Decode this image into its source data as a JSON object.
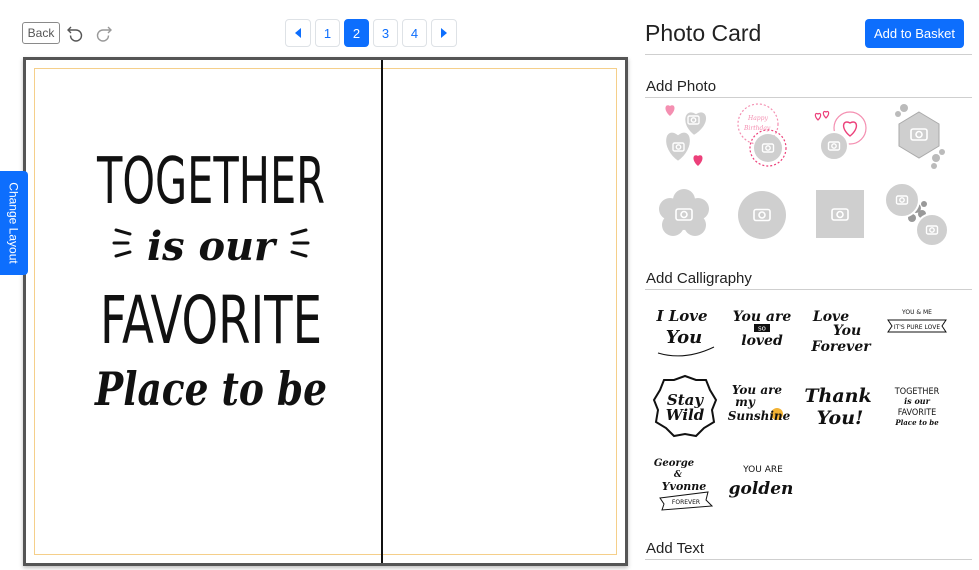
{
  "toolbar": {
    "back_label": "Back",
    "undo_icon": "undo-icon",
    "redo_icon": "redo-icon",
    "pages": [
      "1",
      "2",
      "3",
      "4"
    ],
    "active_page": "2",
    "prev_icon": "caret-left-icon",
    "next_icon": "caret-right-icon"
  },
  "canvas": {
    "art_lines": [
      "TOGETHER",
      "is our",
      "FAVORITE",
      "Place to be"
    ],
    "change_layout_label": "Change Layout"
  },
  "panel": {
    "title": "Photo Card",
    "add_to_basket_label": "Add to Basket",
    "sections": {
      "add_photo": "Add Photo",
      "add_calligraphy": "Add Calligraphy",
      "add_text": "Add Text"
    },
    "photo_frames": [
      "hearts-frame",
      "happy-birthday-frame",
      "love-hearts-frame",
      "floral-hexagon-frame",
      "flower-frame",
      "circle-frame",
      "square-frame",
      "floral-circles-frame"
    ],
    "calligraphy": [
      {
        "lines": [
          "I Love",
          "You"
        ]
      },
      {
        "lines": [
          "You are",
          "so",
          "loved"
        ]
      },
      {
        "lines": [
          "Love",
          "You",
          "Forever"
        ]
      },
      {
        "lines": [
          "YOU & ME",
          "IT'S PURE LOVE"
        ]
      },
      {
        "lines": [
          "Stay",
          "Wild"
        ]
      },
      {
        "lines": [
          "You are",
          "my",
          "Sunshine"
        ]
      },
      {
        "lines": [
          "Thank",
          "You!"
        ]
      },
      {
        "lines": [
          "TOGETHER",
          "is our",
          "FAVORITE",
          "Place to be"
        ]
      },
      {
        "lines": [
          "George",
          "&",
          "Yvonne",
          "FOREVER"
        ]
      },
      {
        "lines": [
          "YOU ARE",
          "golden"
        ]
      }
    ],
    "colors": {
      "accent": "#0d6efd",
      "heart_pink": "#f06292",
      "frame_gray": "#cccccc"
    }
  }
}
